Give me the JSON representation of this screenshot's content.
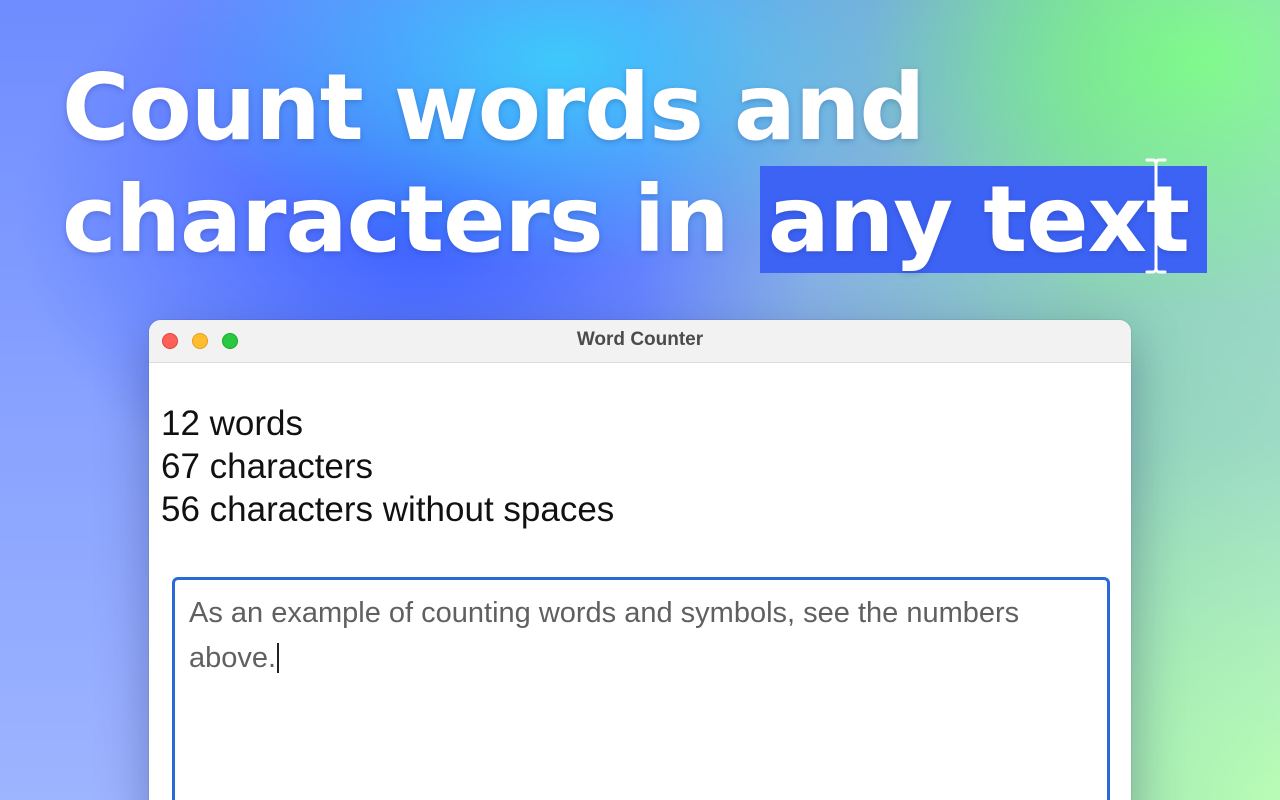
{
  "headline": {
    "line1": "Count words and",
    "line2_prefix": "characters in ",
    "line2_highlight": "any text"
  },
  "colors": {
    "highlight": "#3d63f5",
    "editor_border": "#2a6ad8",
    "traffic_close": "#fe5f57",
    "traffic_minimize": "#febc2e",
    "traffic_zoom": "#28c840"
  },
  "window": {
    "title": "Word Counter"
  },
  "stats": {
    "words": "12 words",
    "characters": "67 characters",
    "characters_no_spaces": "56 characters without spaces"
  },
  "editor": {
    "value": "As an example of counting words and symbols, see the numbers above."
  },
  "icons": {
    "cursor": "text-cursor-ibeam-icon"
  }
}
